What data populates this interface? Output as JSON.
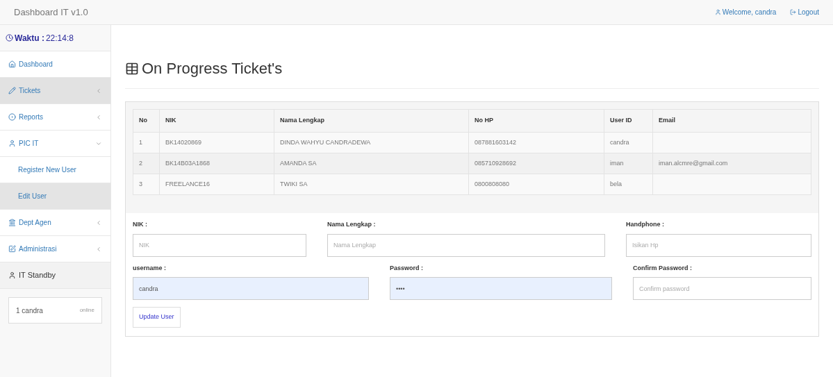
{
  "navbar": {
    "brand": "Dashboard IT v1.0",
    "links": [
      {
        "kind": "user",
        "label": "Welcome, candra"
      },
      {
        "kind": "logout",
        "label": "Logout"
      }
    ]
  },
  "sidebar": {
    "clock": {
      "label": "Waktu :",
      "time": "22:14:8"
    },
    "items": [
      {
        "kind": "link",
        "label": "Dashboard",
        "selected": false
      },
      {
        "kind": "menu",
        "label": "Tickets",
        "selected": true
      },
      {
        "kind": "menu",
        "label": "Reports",
        "selected": false
      },
      {
        "kind": "menu",
        "label": "PIC IT",
        "selected": false,
        "expanded": true,
        "children": [
          {
            "label": "Register New User",
            "selected": false
          },
          {
            "label": "Edit User",
            "selected": true
          }
        ]
      },
      {
        "kind": "menu",
        "label": "Dept Agen",
        "selected": false
      },
      {
        "kind": "menu",
        "label": "Administrasi",
        "selected": false
      }
    ],
    "standby": {
      "title": "IT Standby",
      "users": [
        {
          "name": "1 candra",
          "status": "online"
        }
      ]
    }
  },
  "page": {
    "title": "On Progress Ticket's"
  },
  "table": {
    "columns": [
      "No",
      "NIK",
      "Nama Lengkap",
      "No HP",
      "User ID",
      "Email"
    ],
    "rows": [
      [
        "1",
        "BK14020869",
        "DINDA WAHYU CANDRADEWA",
        "087881603142",
        "candra",
        null
      ],
      [
        "2",
        "BK14B03A1868",
        "AMANDA SA",
        "085710928692",
        "iman",
        "iman.alcmre@gmail.com"
      ],
      [
        "3",
        "FREELANCE16",
        "TWIKI SA",
        "0800808080",
        "bela",
        null
      ]
    ]
  },
  "form": {
    "rows": [
      [
        {
          "label": "NIK :",
          "placeholder": "NIK"
        },
        {
          "label": "Nama Lengkap :",
          "placeholder": "Nama Lengkap"
        },
        {
          "label": "Handphone :",
          "placeholder": "Isikan Hp"
        }
      ],
      [
        {
          "label": "username :",
          "value": "candra"
        },
        {
          "label": "Password :",
          "value": "••••"
        },
        {
          "label": "Confirm Password :",
          "placeholder": "Confirm password"
        }
      ]
    ],
    "button": "Update User"
  }
}
